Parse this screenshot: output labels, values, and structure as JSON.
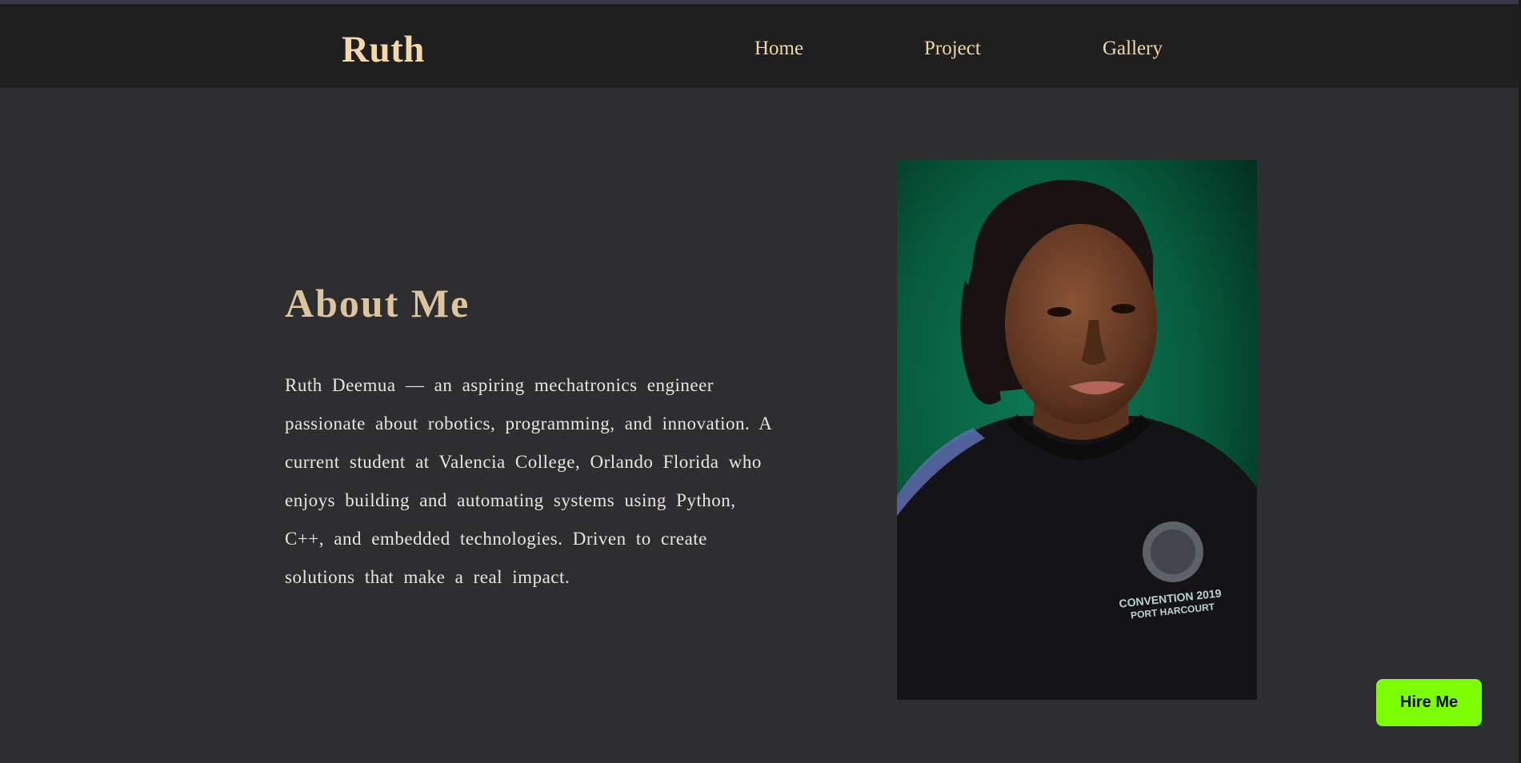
{
  "header": {
    "brand": "Ruth",
    "nav": [
      {
        "label": "Home"
      },
      {
        "label": "Project"
      },
      {
        "label": "Gallery"
      }
    ]
  },
  "about": {
    "heading": "About Me",
    "lines": [
      "Ruth Deemua — an aspiring mechatronics engineer",
      "passionate about robotics, programming, and innovation. A",
      "current student at Valencia College, Orlando Florida who",
      "enjoys building and automating systems using Python,",
      "C++, and embedded technologies. Driven to create",
      "solutions that make a real impact."
    ]
  },
  "portrait": {
    "shirt_text_line1": "CONVENTION 2019",
    "shirt_text_line2": "PORT HARCOURT"
  },
  "cta": {
    "hire_label": "Hire Me"
  },
  "colors": {
    "background": "#2e2d2f",
    "navbar": "#1f1f1f",
    "brand": "#f4d8a8",
    "heading": "#dcc49d",
    "accent_button": "#7cff00",
    "photo_backdrop": "#0a6a4a"
  }
}
